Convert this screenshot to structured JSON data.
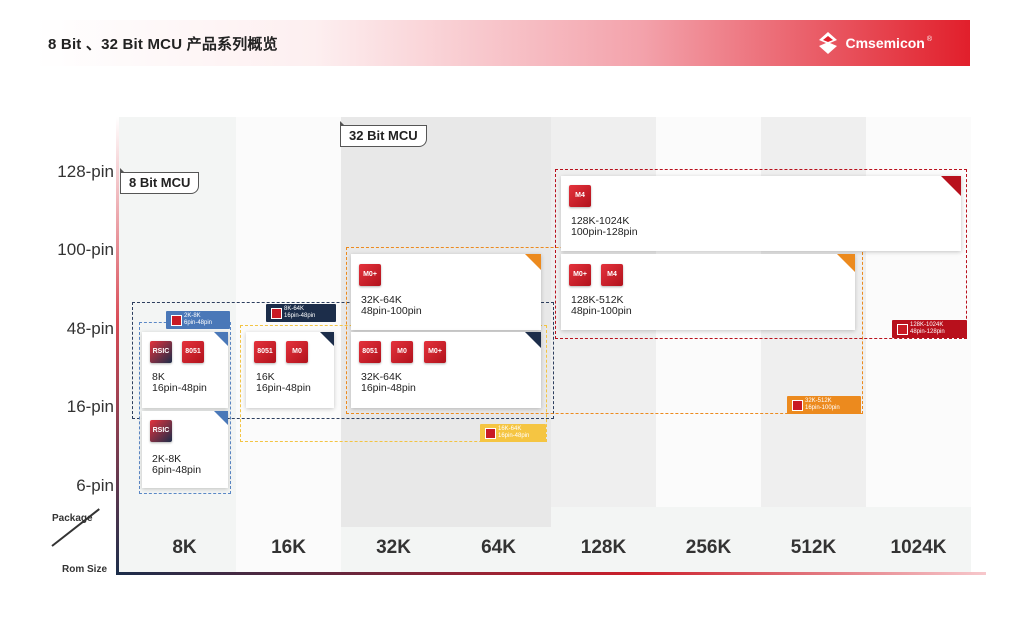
{
  "header": {
    "title": "8 Bit 、32 Bit MCU 产品系列概览",
    "brand": "Cmsemicon",
    "brand_mark": "®",
    "gradient_end": "#e11f2b"
  },
  "axes": {
    "y_labels": [
      "128-pin",
      "100-pin",
      "48-pin",
      "16-pin",
      "6-pin"
    ],
    "x_labels": [
      "8K",
      "16K",
      "32K",
      "64K",
      "128K",
      "256K",
      "512K",
      "1024K"
    ],
    "corner_top": "Package",
    "corner_bottom": "Rom Size"
  },
  "groups": {
    "bit8": "8 Bit MCU",
    "bit32": "32 Bit MCU"
  },
  "cards": [
    {
      "name": "card-rsic-8k",
      "chips": [
        "RSIC",
        "8051"
      ],
      "line1": "8K",
      "line2": "16pin-48pin",
      "corner": "#4a78b8"
    },
    {
      "name": "card-rsic-2k8k",
      "chips": [
        "RSIC"
      ],
      "line1": "2K-8K",
      "line2": "6pin-48pin",
      "corner": "#4a78b8"
    },
    {
      "name": "card-16k",
      "chips": [
        "8051",
        "M0"
      ],
      "line1": "16K",
      "line2": "16pin-48pin",
      "corner": "#1c2d4a"
    },
    {
      "name": "card-32k64k-48",
      "chips": [
        "M0+"
      ],
      "line1": "32K-64K",
      "line2": "48pin-100pin",
      "corner": "#ec8a1e"
    },
    {
      "name": "card-32k64k-16",
      "chips": [
        "8051",
        "M0",
        "M0+"
      ],
      "line1": "32K-64K",
      "line2": "16pin-48pin",
      "corner": "#1c2d4a"
    },
    {
      "name": "card-128k1024k",
      "chips": [
        "M4"
      ],
      "line1": "128K-1024K",
      "line2": "100pin-128pin",
      "corner": "#b8101c"
    },
    {
      "name": "card-128k512k",
      "chips": [
        "M0+",
        "M4"
      ],
      "line1": "128K-512K",
      "line2": "48pin-100pin",
      "corner": "#ec8a1e"
    }
  ],
  "badges": [
    {
      "name": "badge-2k8k",
      "l1": "2K-8K",
      "l2": "6pin-48pin",
      "color": "#4a78b8"
    },
    {
      "name": "badge-8k64k",
      "l1": "8K-64K",
      "l2": "16pin-48pin",
      "color": "#1c2d4a"
    },
    {
      "name": "badge-16k64k",
      "l1": "16K-64K",
      "l2": "16pin-48pin",
      "color": "#f5c542"
    },
    {
      "name": "badge-32k512k",
      "l1": "32K-512K",
      "l2": "16pin-100pin",
      "color": "#ec8a1e"
    },
    {
      "name": "badge-128k1024k",
      "l1": "128K-1024K",
      "l2": "48pin-128pin",
      "color": "#b8101c"
    }
  ]
}
